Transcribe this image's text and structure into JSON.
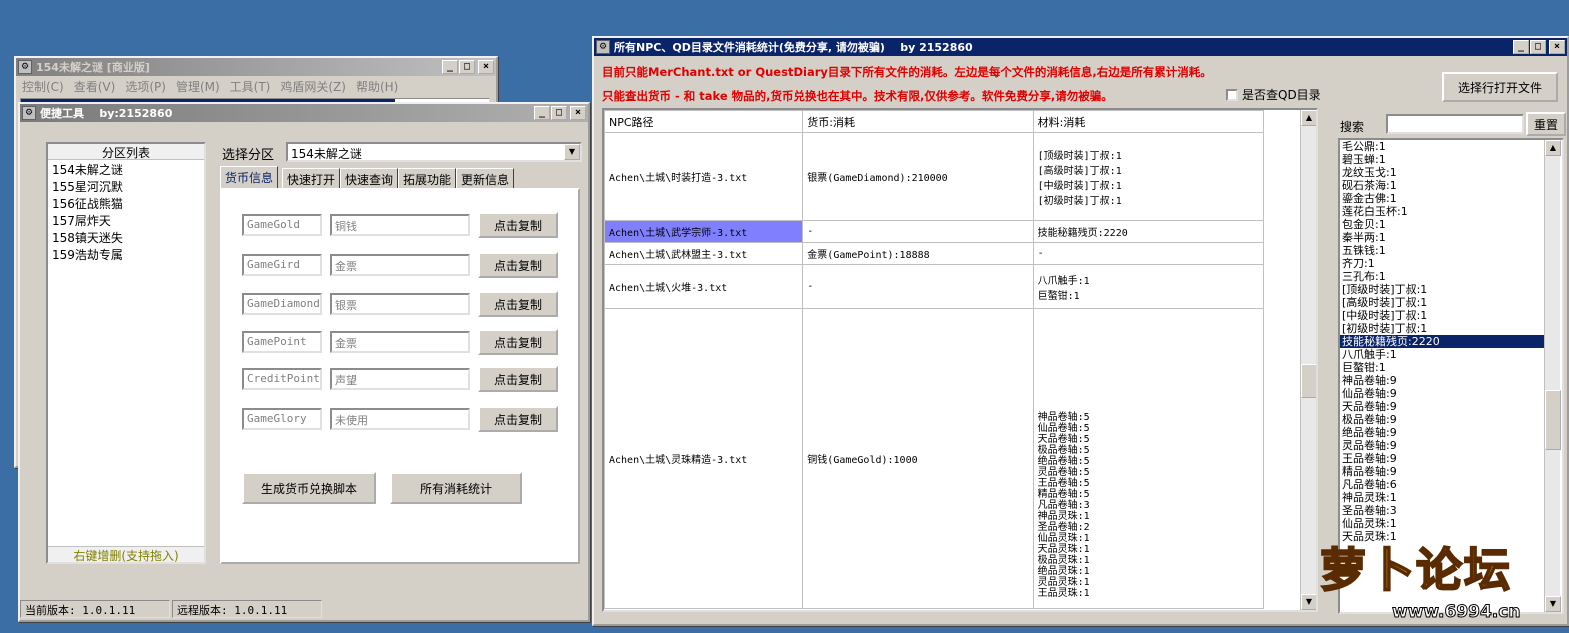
{
  "win_main": {
    "title": "154未解之谜 [商业版]",
    "menu": [
      "控制(C)",
      "查看(V)",
      "选项(P)",
      "管理(M)",
      "工具(T)",
      "鸡盾网关(Z)",
      "帮助(H)"
    ]
  },
  "win_tool": {
    "title": "便捷工具",
    "author": "by:2152860",
    "partition_list_header": "分区列表",
    "partitions": [
      "154未解之谜",
      "155星河沉默",
      "156征战熊猫",
      "157屌炸天",
      "158镇天迷失",
      "159浩劫专属"
    ],
    "partition_footer": "右键增删(支持拖入)",
    "select_label": "选择分区",
    "select_value": "154未解之谜",
    "tabs": [
      "货币信息",
      "快速打开",
      "快速查询",
      "拓展功能",
      "更新信息"
    ],
    "currency_rows": [
      {
        "code": "GameGold",
        "name": "铜钱",
        "button": "点击复制"
      },
      {
        "code": "GameGird",
        "name": "金票",
        "button": "点击复制"
      },
      {
        "code": "GameDiamond",
        "name": "银票",
        "button": "点击复制"
      },
      {
        "code": "GamePoint",
        "name": "金票",
        "button": "点击复制"
      },
      {
        "code": "CreditPoint",
        "name": "声望",
        "button": "点击复制"
      },
      {
        "code": "GameGlory",
        "name": "未使用",
        "button": "点击复制"
      }
    ],
    "gen_button": "生成货币兑换脚本",
    "stats_button": "所有消耗统计",
    "current_version": "当前版本: 1.0.1.11",
    "remote_version": "远程版本: 1.0.1.11"
  },
  "win_stats": {
    "title": "所有NPC、QD目录文件消耗统计(免费分享, 请勿被骗)",
    "author": "by 2152860",
    "notice1": "目前只能MerChant.txt or QuestDiary目录下所有文件的消耗。左边是每个文件的消耗信息,右边是所有累计消耗。",
    "notice2": "只能查出货币 - 和 take 物品的,货币兑换也在其中。技术有限,仅供参考。软件免费分享,请勿被骗。",
    "checkbox_label": "是否查QD目录",
    "open_file_button": "选择行打开文件",
    "search_label": "搜索",
    "reset_button": "重置",
    "columns": [
      "NPC路径",
      "货币:消耗",
      "材料:消耗"
    ],
    "rows": [
      {
        "path": "Achen\\土城\\时装打造-3.txt",
        "currency": "银票(GameDiamond):210000",
        "materials": [
          "[顶级时装]丁叔:1",
          "[高级时装]丁叔:1",
          "[中级时装]丁叔:1",
          "[初级时装]丁叔:1"
        ]
      },
      {
        "path": "Achen\\土城\\武学宗师-3.txt",
        "currency": "-",
        "materials": [
          "技能秘籍残页:2220"
        ]
      },
      {
        "path": "Achen\\土城\\武林盟主-3.txt",
        "currency": "金票(GamePoint):18888",
        "materials": [
          "-"
        ]
      },
      {
        "path": "Achen\\土城\\火堆-3.txt",
        "currency": "-",
        "materials": [
          "八爪触手:1",
          "巨螯钳:1"
        ]
      },
      {
        "path": "Achen\\土城\\灵珠精造-3.txt",
        "currency": "铜钱(GameGold):1000",
        "materials": [
          "神品卷轴:5",
          "仙品卷轴:5",
          "天品卷轴:5",
          "极品卷轴:5",
          "绝品卷轴:5",
          "灵品卷轴:5",
          "王品卷轴:5",
          "精品卷轴:5",
          "凡品卷轴:3",
          "神品灵珠:1",
          "圣品卷轴:2",
          "仙品灵珠:1",
          "天品灵珠:1",
          "极品灵珠:1",
          "绝品灵珠:1",
          "灵品灵珠:1",
          "王品灵珠:1"
        ]
      }
    ],
    "summary": [
      "毛公鼎:1",
      "碧玉蝉:1",
      "龙纹玉戈:1",
      "砚石茶海:1",
      "鎏金古佛:1",
      "莲花白玉杯:1",
      "包金贝:1",
      "秦半两:1",
      "五铢钱:1",
      "齐刀:1",
      "三孔布:1",
      "[顶级时装]丁叔:1",
      "[高级时装]丁叔:1",
      "[中级时装]丁叔:1",
      "[初级时装]丁叔:1",
      "技能秘籍残页:2220",
      "八爪触手:1",
      "巨螯钳:1",
      "神品卷轴:9",
      "仙品卷轴:9",
      "天品卷轴:9",
      "极品卷轴:9",
      "绝品卷轴:9",
      "灵品卷轴:9",
      "王品卷轴:9",
      "精品卷轴:9",
      "凡品卷轴:6",
      "神品灵珠:1",
      "圣品卷轴:3",
      "仙品灵珠:1",
      "天品灵珠:1"
    ],
    "summary_selected_index": 15
  },
  "watermark": {
    "text": "萝卜论坛",
    "url": "www.6994.cn"
  }
}
